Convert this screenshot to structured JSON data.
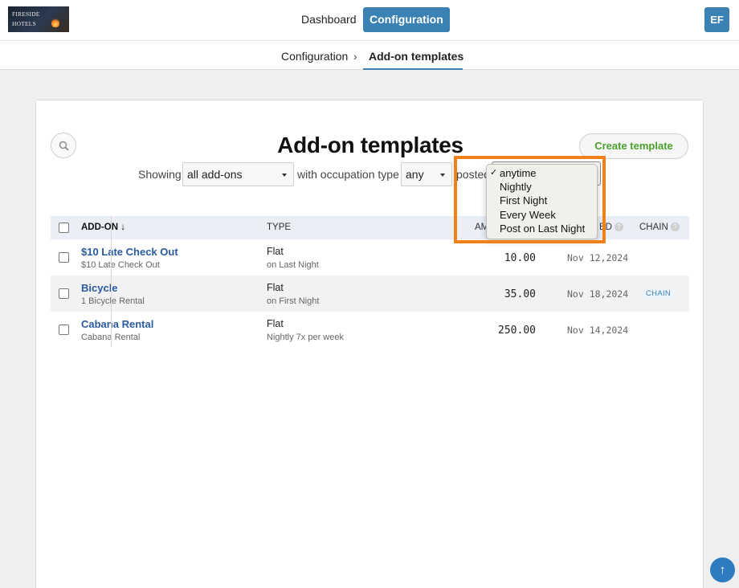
{
  "brand": {
    "logo_line1": "FIRESIDE",
    "logo_line2": "HOTELS"
  },
  "nav": {
    "dashboard": "Dashboard",
    "configuration": "Configuration"
  },
  "user": {
    "initials": "EF"
  },
  "breadcrumb": {
    "parent": "Configuration",
    "separator": "›",
    "current": "Add-on templates"
  },
  "page": {
    "title": "Add-on templates",
    "create_button": "Create template"
  },
  "filters": {
    "showing_label": "Showing",
    "addons_value": "all add-ons",
    "occupation_label": "with occupation type",
    "occupation_value": "any",
    "posted_label": "posted"
  },
  "posted_menu": {
    "selected": "anytime",
    "options": [
      "anytime",
      "Nightly",
      "First Night",
      "Every Week",
      "Post on Last Night"
    ]
  },
  "table": {
    "headers": {
      "addon": "ADD-ON ↓",
      "type": "TYPE",
      "amount": "AM",
      "dated": "ED",
      "chain": "CHAIN",
      "help": "?"
    },
    "rows": [
      {
        "name": "$10 Late Check Out",
        "sub": "$10 Late Check Out",
        "type": "Flat",
        "type_sub": "on Last Night",
        "amount": "10.00",
        "date": "Nov 12,2024",
        "chain": ""
      },
      {
        "name": "Bicycle",
        "sub": "1 Bicycle Rental",
        "type": "Flat",
        "type_sub": "on First Night",
        "amount": "35.00",
        "date": "Nov 18,2024",
        "chain": "CHAIN"
      },
      {
        "name": "Cabana Rental",
        "sub": "Cabana Rental",
        "type": "Flat",
        "type_sub": "Nightly 7x per week",
        "amount": "250.00",
        "date": "Nov 14,2024",
        "chain": ""
      }
    ]
  },
  "colors": {
    "accent": "#3b82b4",
    "create_text": "#4aa02c",
    "highlight": "#f08019",
    "link": "#2a5aa0"
  },
  "icons": {
    "search": "search-icon",
    "scroll_top": "arrow-up-icon",
    "caret": "caret-down-icon",
    "check": "checkmark-icon"
  }
}
